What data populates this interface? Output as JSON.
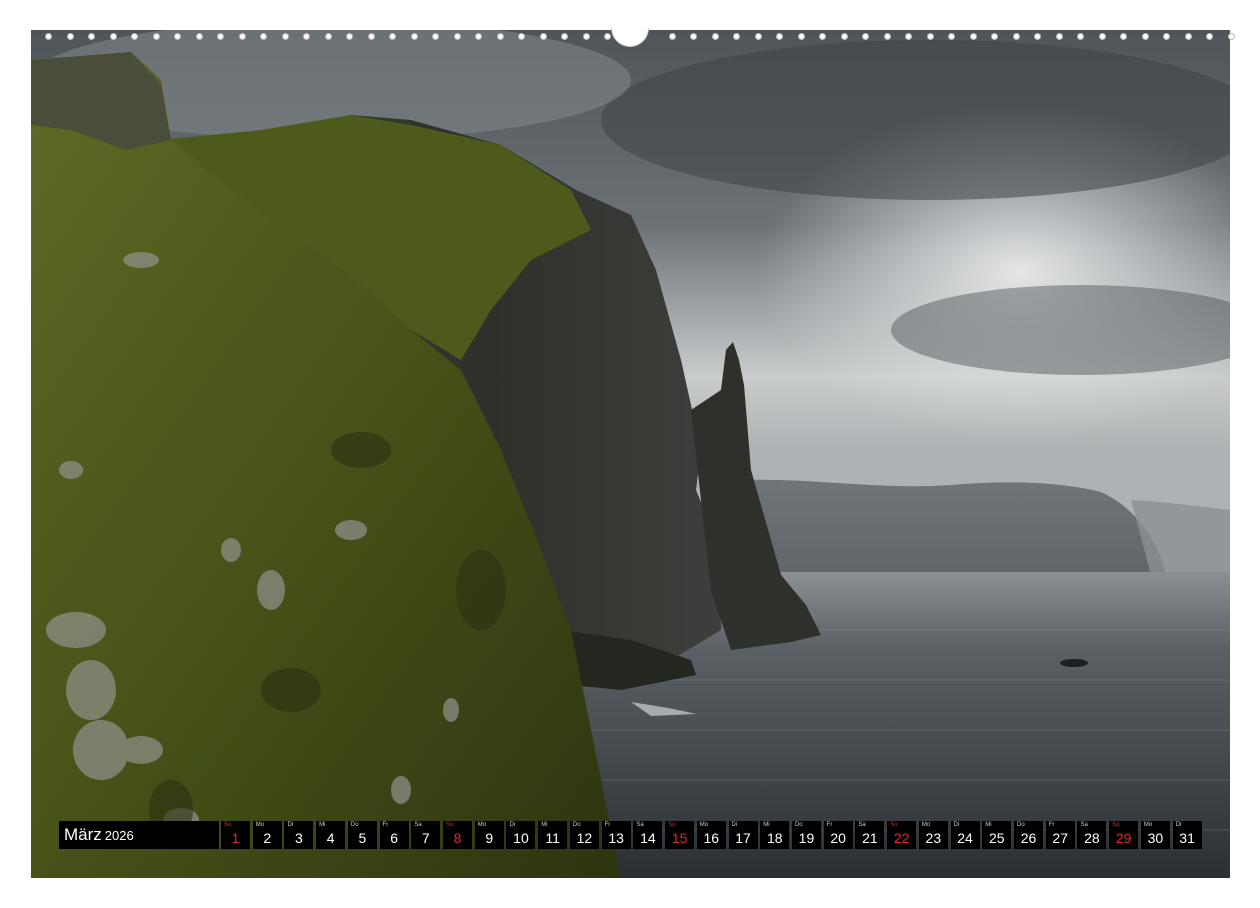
{
  "calendar": {
    "month": "März",
    "year": "2026",
    "days": [
      {
        "weekday": "So",
        "day": "1",
        "sunday": true
      },
      {
        "weekday": "Mo",
        "day": "2",
        "sunday": false
      },
      {
        "weekday": "Di",
        "day": "3",
        "sunday": false
      },
      {
        "weekday": "Mi",
        "day": "4",
        "sunday": false
      },
      {
        "weekday": "Do",
        "day": "5",
        "sunday": false
      },
      {
        "weekday": "Fr",
        "day": "6",
        "sunday": false
      },
      {
        "weekday": "Sa",
        "day": "7",
        "sunday": false
      },
      {
        "weekday": "So",
        "day": "8",
        "sunday": true
      },
      {
        "weekday": "Mo",
        "day": "9",
        "sunday": false
      },
      {
        "weekday": "Di",
        "day": "10",
        "sunday": false
      },
      {
        "weekday": "Mi",
        "day": "11",
        "sunday": false
      },
      {
        "weekday": "Do",
        "day": "12",
        "sunday": false
      },
      {
        "weekday": "Fr",
        "day": "13",
        "sunday": false
      },
      {
        "weekday": "Sa",
        "day": "14",
        "sunday": false
      },
      {
        "weekday": "So",
        "day": "15",
        "sunday": true
      },
      {
        "weekday": "Mo",
        "day": "16",
        "sunday": false
      },
      {
        "weekday": "Di",
        "day": "17",
        "sunday": false
      },
      {
        "weekday": "Mi",
        "day": "18",
        "sunday": false
      },
      {
        "weekday": "Do",
        "day": "19",
        "sunday": false
      },
      {
        "weekday": "Fr",
        "day": "20",
        "sunday": false
      },
      {
        "weekday": "Sa",
        "day": "21",
        "sunday": false
      },
      {
        "weekday": "So",
        "day": "22",
        "sunday": true
      },
      {
        "weekday": "Mo",
        "day": "23",
        "sunday": false
      },
      {
        "weekday": "Di",
        "day": "24",
        "sunday": false
      },
      {
        "weekday": "Mi",
        "day": "25",
        "sunday": false
      },
      {
        "weekday": "Do",
        "day": "26",
        "sunday": false
      },
      {
        "weekday": "Fr",
        "day": "27",
        "sunday": false
      },
      {
        "weekday": "Sa",
        "day": "28",
        "sunday": false
      },
      {
        "weekday": "So",
        "day": "29",
        "sunday": true
      },
      {
        "weekday": "Mo",
        "day": "30",
        "sunday": false
      },
      {
        "weekday": "Di",
        "day": "31",
        "sunday": false
      }
    ]
  },
  "colors": {
    "strip_background": "#000000",
    "sunday_red": "#e0262c",
    "day_text": "#ffffff"
  }
}
